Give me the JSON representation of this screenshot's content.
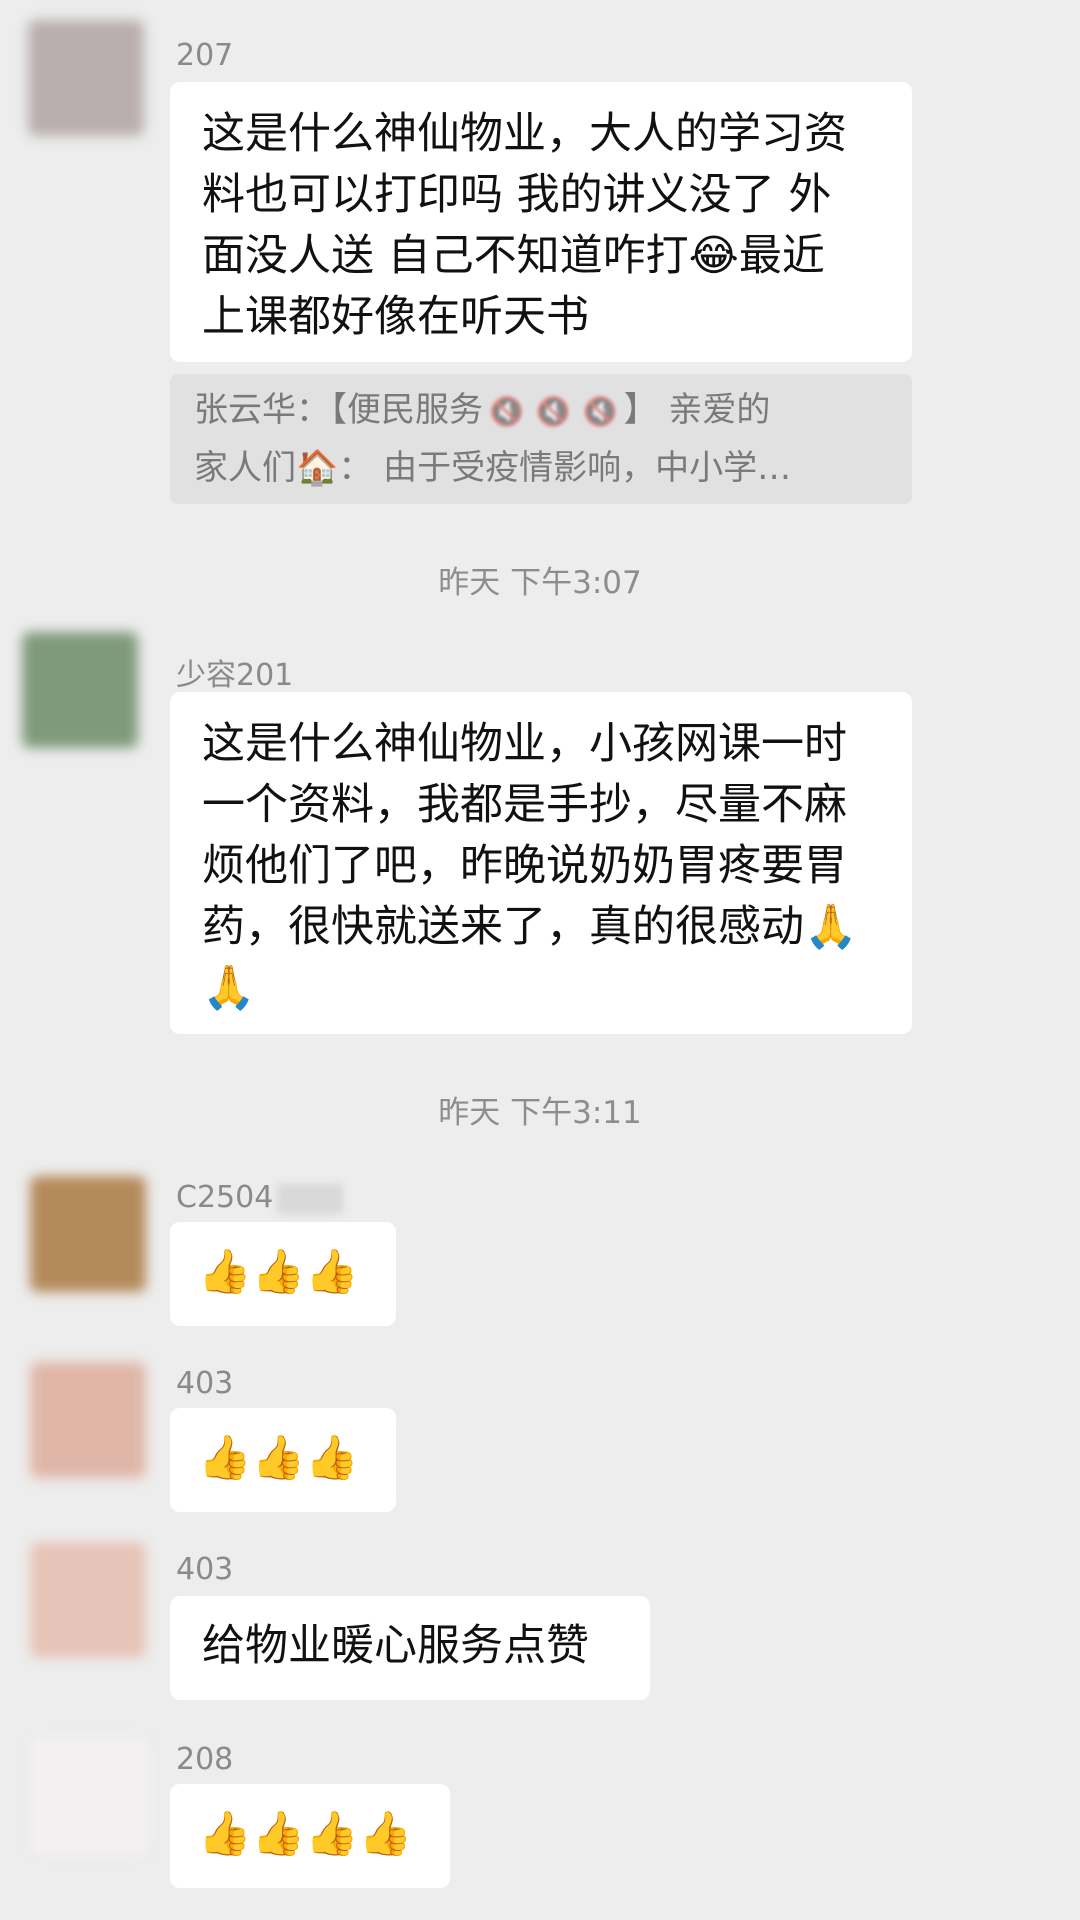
{
  "messages": [
    {
      "sender": "207",
      "avatar_color": "#b9aeae",
      "lines": [
        "这是什么神仙物业，大人的学习资",
        "料也可以打印吗 我的讲义没了 外",
        "面没人送 自己不知道咋打😂最近",
        "上课都好像在听天书"
      ],
      "quote": {
        "line1_prefix": "张云华：【便民服务",
        "line1_suffix": "】 亲爱的",
        "line2": "家人们🏠： 由于受疫情影响，中小学…"
      }
    },
    {
      "sender": "少容201",
      "avatar_color": "#7f9a7a",
      "lines": [
        "这是什么神仙物业，小孩网课一时",
        "一个资料，我都是手抄，尽量不麻",
        "烦他们了吧，昨晚说奶奶胃疼要胃",
        "药，很快就送来了，真的很感动🙏",
        "🙏"
      ]
    },
    {
      "sender": "C2504",
      "avatar_color": "#b48a5a",
      "emoji": "👍👍👍"
    },
    {
      "sender": "403",
      "avatar_color": "#e0b6a8",
      "emoji": "👍👍👍"
    },
    {
      "sender": "403",
      "avatar_color": "#e6c4b8",
      "text": "给物业暖心服务点赞"
    },
    {
      "sender": "208",
      "avatar_color": "#f4f0f2",
      "emoji": "👍👍👍👍"
    }
  ],
  "timestamps": [
    "昨天 下午3:07",
    "昨天 下午3:11"
  ],
  "mute_icon": "🔇"
}
